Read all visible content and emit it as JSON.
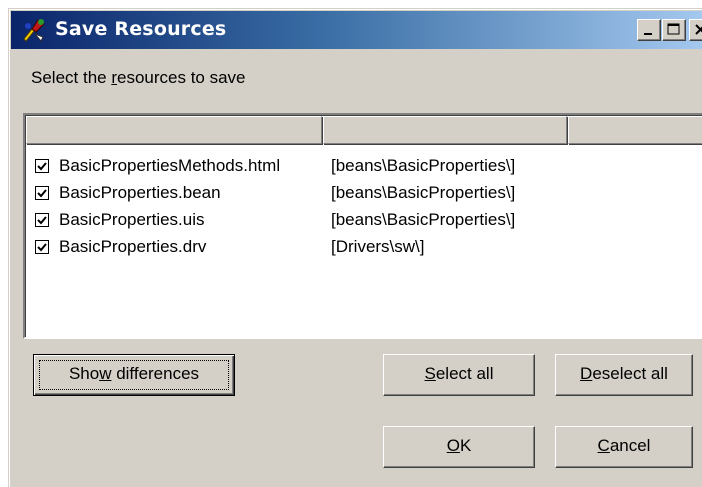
{
  "window": {
    "title": "Save Resources"
  },
  "dialog": {
    "instruction": {
      "before": "Select the ",
      "accel": "r",
      "after": "esources to save"
    },
    "columns": [
      "",
      "",
      ""
    ],
    "resources": [
      {
        "checked": true,
        "name": "BasicPropertiesMethods.html",
        "path": "[beans\\BasicProperties\\]"
      },
      {
        "checked": true,
        "name": "BasicProperties.bean",
        "path": "[beans\\BasicProperties\\]"
      },
      {
        "checked": true,
        "name": "BasicProperties.uis",
        "path": "[beans\\BasicProperties\\]"
      },
      {
        "checked": true,
        "name": "BasicProperties.drv",
        "path": "[Drivers\\sw\\]"
      }
    ]
  },
  "buttons": {
    "show_differences": {
      "before": "Sho",
      "accel": "w",
      "after": " differences"
    },
    "select_all": {
      "before": "",
      "accel": "S",
      "after": "elect all"
    },
    "deselect_all": {
      "before": "",
      "accel": "D",
      "after": "eselect all"
    },
    "ok": {
      "before": "",
      "accel": "O",
      "after": "K"
    },
    "cancel": {
      "before": "",
      "accel": "C",
      "after": "ancel"
    }
  },
  "icons": {
    "app": "multicolor-resource-icon",
    "minimize": "minimize-icon",
    "maximize": "maximize-icon",
    "close": "close-icon",
    "check": "checkmark-icon"
  },
  "colors": {
    "titlebar_start": "#0a246a",
    "titlebar_end": "#a6caf0",
    "face": "#d4d0c8"
  }
}
